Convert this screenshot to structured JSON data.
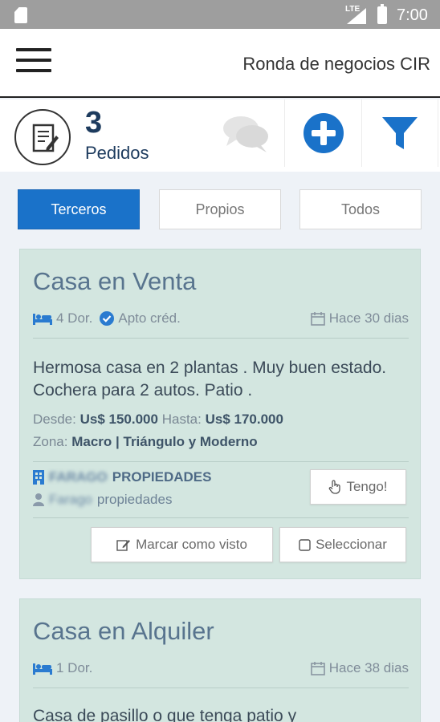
{
  "status_bar": {
    "network": "LTE",
    "time": "7:00"
  },
  "app_bar": {
    "title": "Ronda de negocios CIR"
  },
  "summary": {
    "count": "3",
    "label": "Pedidos"
  },
  "colors": {
    "accent": "#1a72c9",
    "card_bg": "#d3e6e0",
    "title": "#58748e"
  },
  "icons": {
    "menu": "hamburger-icon",
    "requests": "edit-document-icon",
    "chat": "chat-bubbles-icon",
    "add": "plus-circle-icon",
    "filter": "filter-funnel-icon"
  },
  "tabs": [
    {
      "label": "Terceros",
      "active": true
    },
    {
      "label": "Propios",
      "active": false
    },
    {
      "label": "Todos",
      "active": false
    }
  ],
  "cards": [
    {
      "title": "Casa en Venta",
      "bedrooms": "4 Dor.",
      "credit": "Apto créd.",
      "age": "Hace 30 dias",
      "description": "Hermosa casa en 2 plantas . Muy buen estado. Cochera para 2 autos. Patio .",
      "desde_label": "Desde:",
      "desde": "Us$ 150.000",
      "hasta_label": "Hasta:",
      "hasta": "Us$ 170.000",
      "zona_label": "Zona:",
      "zona": "Macro | Triángulo y Moderno",
      "agency_name": "FARAGO",
      "agency_suffix": "PROPIEDADES",
      "agent_name": "Farago",
      "agent_suffix": "propiedades",
      "tengo_label": "Tengo!",
      "marcar_label": "Marcar como visto",
      "seleccionar_label": "Seleccionar"
    },
    {
      "title": "Casa en Alquiler",
      "bedrooms": "1 Dor.",
      "age": "Hace 38 dias",
      "description": "Casa de pasillo o que tenga patio y"
    }
  ]
}
